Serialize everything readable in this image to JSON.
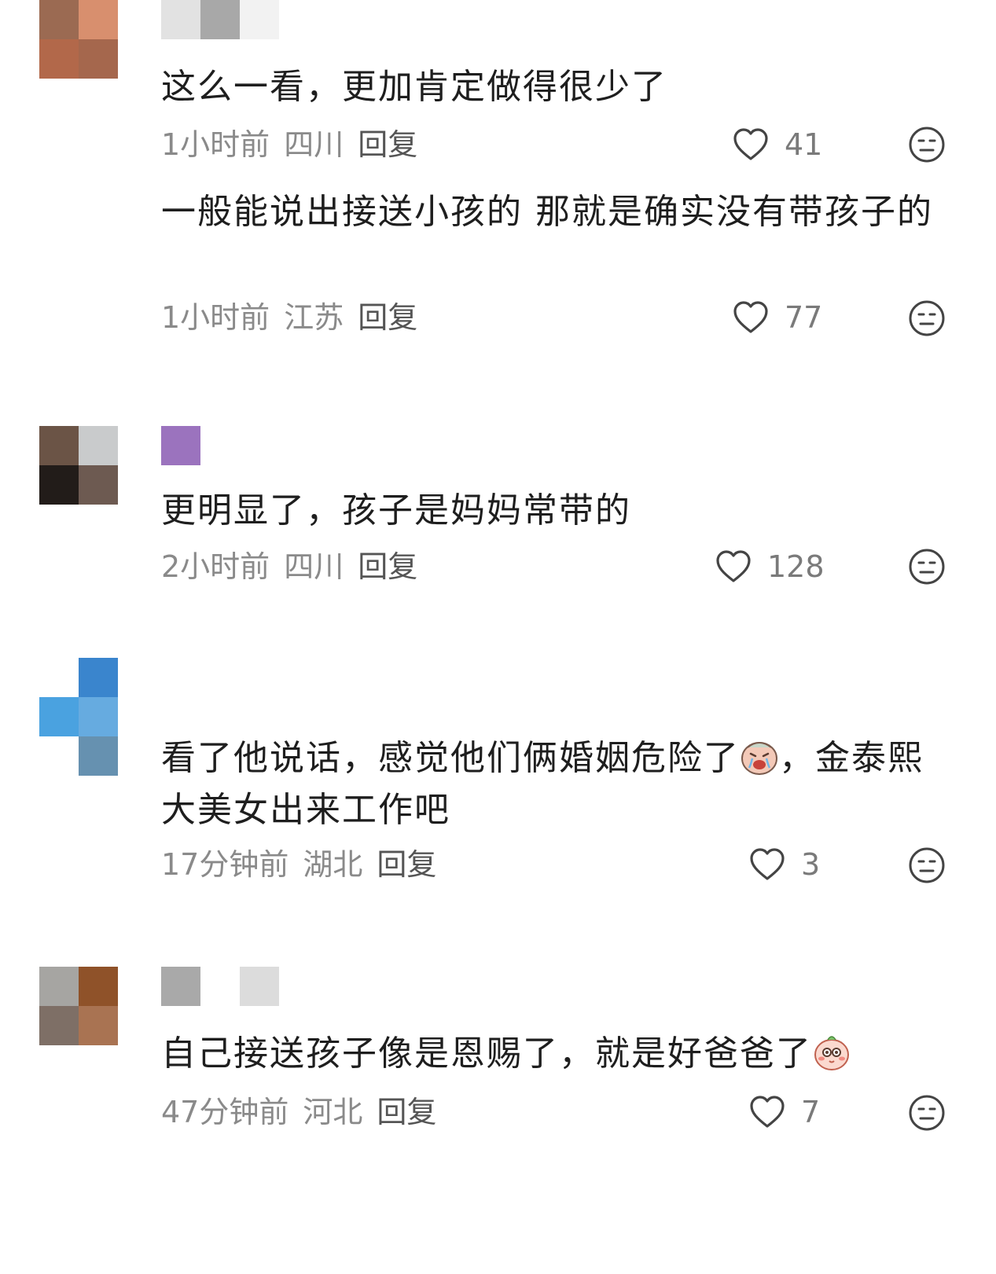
{
  "comments": [
    {
      "content": "这么一看，更加肯定做得很少了",
      "time": "1小时前",
      "location": "四川",
      "reply_label": "回复",
      "likes": "41",
      "avatar_colors": [
        "#9b6a52",
        "#d88f6e",
        "#b2684a",
        "#a5674d"
      ],
      "nick_colors": [
        "#e2e2e2",
        "#a8a8a8",
        "#f2f2f2"
      ]
    },
    {
      "content": "一般能说出接送小孩的 那就是确实没有带孩子的",
      "time": "1小时前",
      "location": "江苏",
      "reply_label": "回复",
      "likes": "77"
    },
    {
      "content": "更明显了，孩子是妈妈常带的",
      "time": "2小时前",
      "location": "四川",
      "reply_label": "回复",
      "likes": "128",
      "avatar_colors": [
        "#6b5446",
        "#c9cbcc",
        "#221c19",
        "#6d5a51"
      ],
      "nick_colors": [
        "#9b73be"
      ]
    },
    {
      "content_part1": "看了他说话，感觉他们俩婚姻危险了",
      "content_part2": "，金泰熙大美女出来工作吧",
      "time": "17分钟前",
      "location": "湖北",
      "reply_label": "回复",
      "likes": "3",
      "avatar_colors": [
        "#ffffff",
        "#3a85cd",
        "#4aa2e0",
        "#66abe0",
        "#ffffff",
        "#6691b0"
      ]
    },
    {
      "content_part1": "自己接送孩子像是恩赐了，就是好爸爸了",
      "time": "47分钟前",
      "location": "河北",
      "reply_label": "回复",
      "likes": "7",
      "avatar_colors": [
        "#a6a5a2",
        "#8f5229",
        "#7e6f66",
        "#a97352"
      ],
      "nick_colors": [
        "#a9a9a9",
        "#ffffff",
        "#dcdcdc"
      ]
    }
  ],
  "icons": {
    "like": "heart-outline-icon",
    "dislike": "neutral-face-icon",
    "emoji_1": "crying-face-sticker-icon",
    "emoji_2": "blushing-face-sticker-icon"
  },
  "colors": {
    "text": "#1e1e1e",
    "meta": "#8a8a8a",
    "icon": "#444444"
  }
}
